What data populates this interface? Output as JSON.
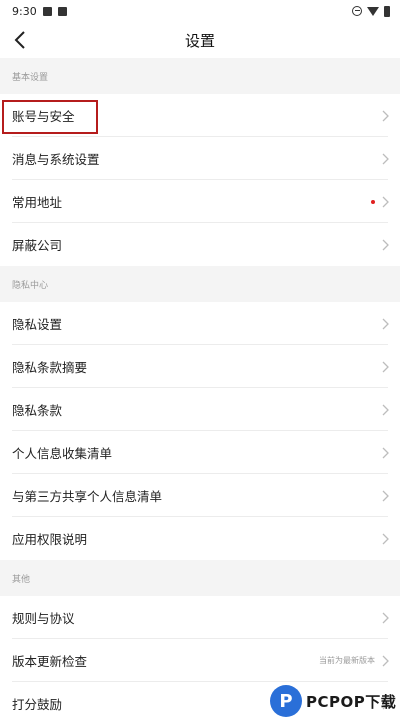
{
  "status_bar": {
    "time": "9:30",
    "left_icons": [
      "photo-icon",
      "notification-icon"
    ],
    "right_icons": [
      "dnd-icon",
      "wifi-icon",
      "battery-icon"
    ]
  },
  "nav": {
    "title": "设置",
    "back_icon": "chevron-left-icon"
  },
  "sections": [
    {
      "header": "基本设置",
      "items": [
        {
          "label": "账号与安全"
        },
        {
          "label": "消息与系统设置"
        },
        {
          "label": "常用地址",
          "badge": "red-dot"
        },
        {
          "label": "屏蔽公司"
        }
      ]
    },
    {
      "header": "隐私中心",
      "items": [
        {
          "label": "隐私设置"
        },
        {
          "label": "隐私条款摘要"
        },
        {
          "label": "隐私条款"
        },
        {
          "label": "个人信息收集清单"
        },
        {
          "label": "与第三方共享个人信息清单"
        },
        {
          "label": "应用权限说明"
        }
      ]
    },
    {
      "header": "其他",
      "items": [
        {
          "label": "规则与协议"
        },
        {
          "label": "版本更新检查",
          "value": "当前为最新版本"
        },
        {
          "label": "打分鼓励"
        }
      ]
    }
  ],
  "colors": {
    "highlight_border": "#b51c1c",
    "red_dot": "#e02020",
    "section_bg": "#f4f4f4"
  },
  "watermark": {
    "logo_letter": "P",
    "text": "PCPOP下载"
  }
}
